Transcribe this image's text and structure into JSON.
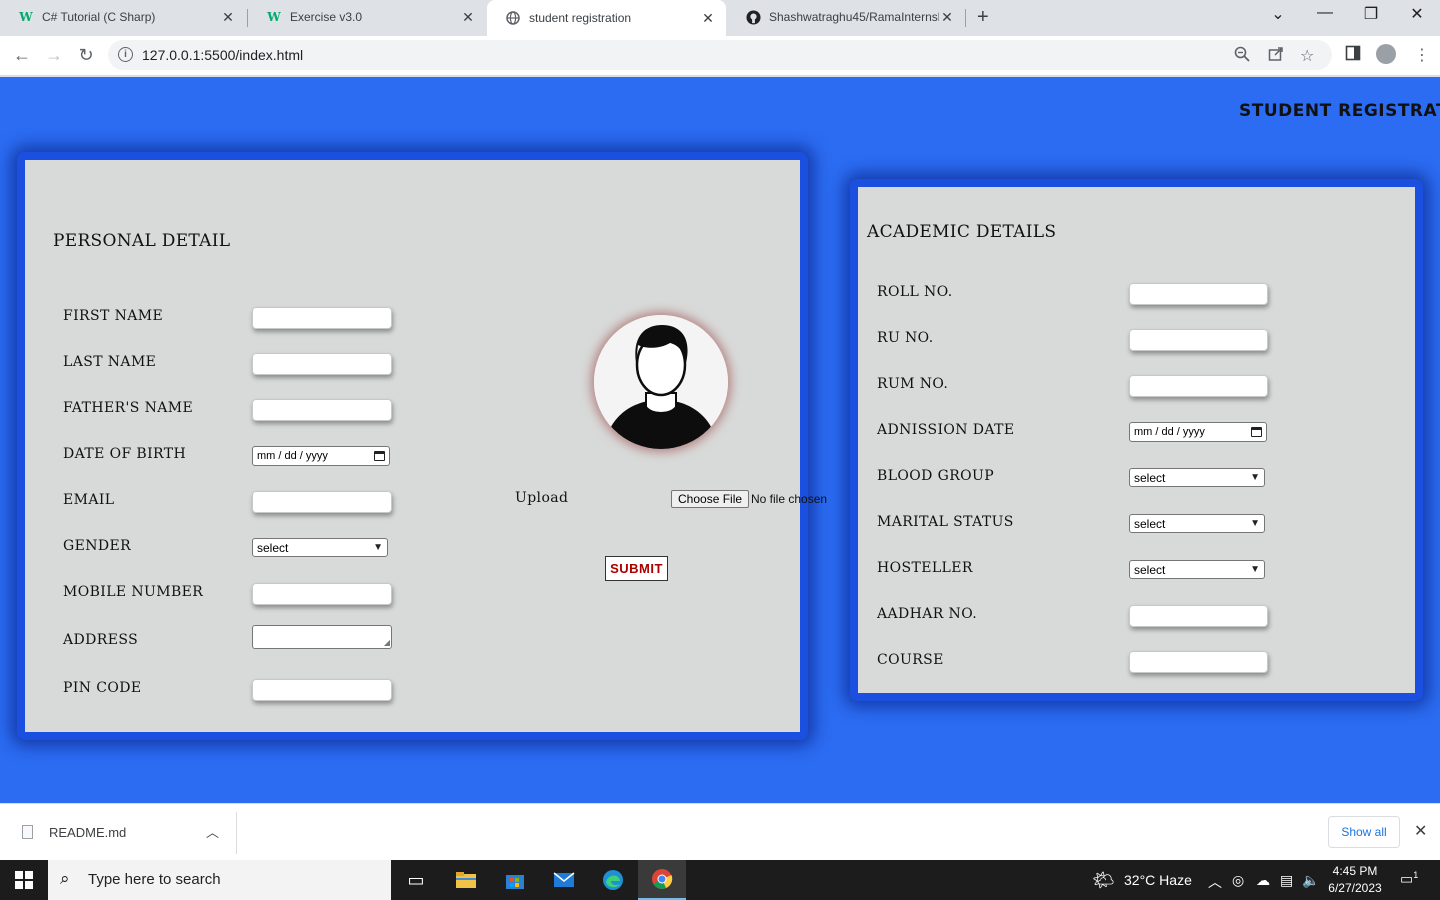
{
  "browser": {
    "tabs": [
      {
        "title": "C# Tutorial (C Sharp)",
        "favicon": "w3schools-icon"
      },
      {
        "title": "Exercise v3.0",
        "favicon": "w3schools-icon"
      },
      {
        "title": "student registration",
        "favicon": "globe-icon"
      },
      {
        "title": "Shashwatraghu45/RamaInternshi",
        "favicon": "github-icon"
      }
    ],
    "active_tab_index": 2,
    "url": "127.0.0.1:5500/index.html"
  },
  "page": {
    "heading": "STUDENT REGISTRATIO",
    "colors": {
      "background": "#2b6cf2",
      "card_border": "#1a4fe0",
      "card_bg": "#d8dad9",
      "submit_text": "#aa0000"
    },
    "personal": {
      "title": "PERSONAL DETAIL",
      "fields": [
        {
          "label": "FIRST NAME",
          "type": "text"
        },
        {
          "label": "LAST NAME",
          "type": "text"
        },
        {
          "label": "FATHER'S NAME",
          "type": "text"
        },
        {
          "label": "DATE OF BIRTH",
          "type": "date",
          "placeholder": "mm / dd / yyyy"
        },
        {
          "label": "EMAIL",
          "type": "text"
        },
        {
          "label": "GENDER",
          "type": "select",
          "value": "select"
        },
        {
          "label": "MOBILE NUMBER",
          "type": "text"
        },
        {
          "label": "ADDRESS",
          "type": "textarea"
        },
        {
          "label": "PIN CODE",
          "type": "text"
        }
      ],
      "upload_label": "Upload",
      "file_button": "Choose File",
      "file_status": "No file chosen",
      "submit": "SUBMIT"
    },
    "academic": {
      "title": "ACADEMIC DETAILS",
      "fields": [
        {
          "label": "ROLL NO.",
          "type": "text"
        },
        {
          "label": "RU NO.",
          "type": "text"
        },
        {
          "label": "RUM NO.",
          "type": "text"
        },
        {
          "label": "ADNISSION DATE",
          "type": "date",
          "placeholder": "mm / dd / yyyy"
        },
        {
          "label": "BLOOD GROUP",
          "type": "select",
          "value": "select"
        },
        {
          "label": "MARITAL STATUS",
          "type": "select",
          "value": "select"
        },
        {
          "label": "HOSTELLER",
          "type": "select",
          "value": "select"
        },
        {
          "label": "AADHAR NO.",
          "type": "text"
        },
        {
          "label": "COURSE",
          "type": "text"
        }
      ]
    }
  },
  "downloads": {
    "file": "README.md",
    "show_all": "Show all"
  },
  "taskbar": {
    "search_placeholder": "Type here to search",
    "weather": "32°C  Haze",
    "time": "4:45 PM",
    "date": "6/27/2023",
    "notification_count": "1"
  }
}
